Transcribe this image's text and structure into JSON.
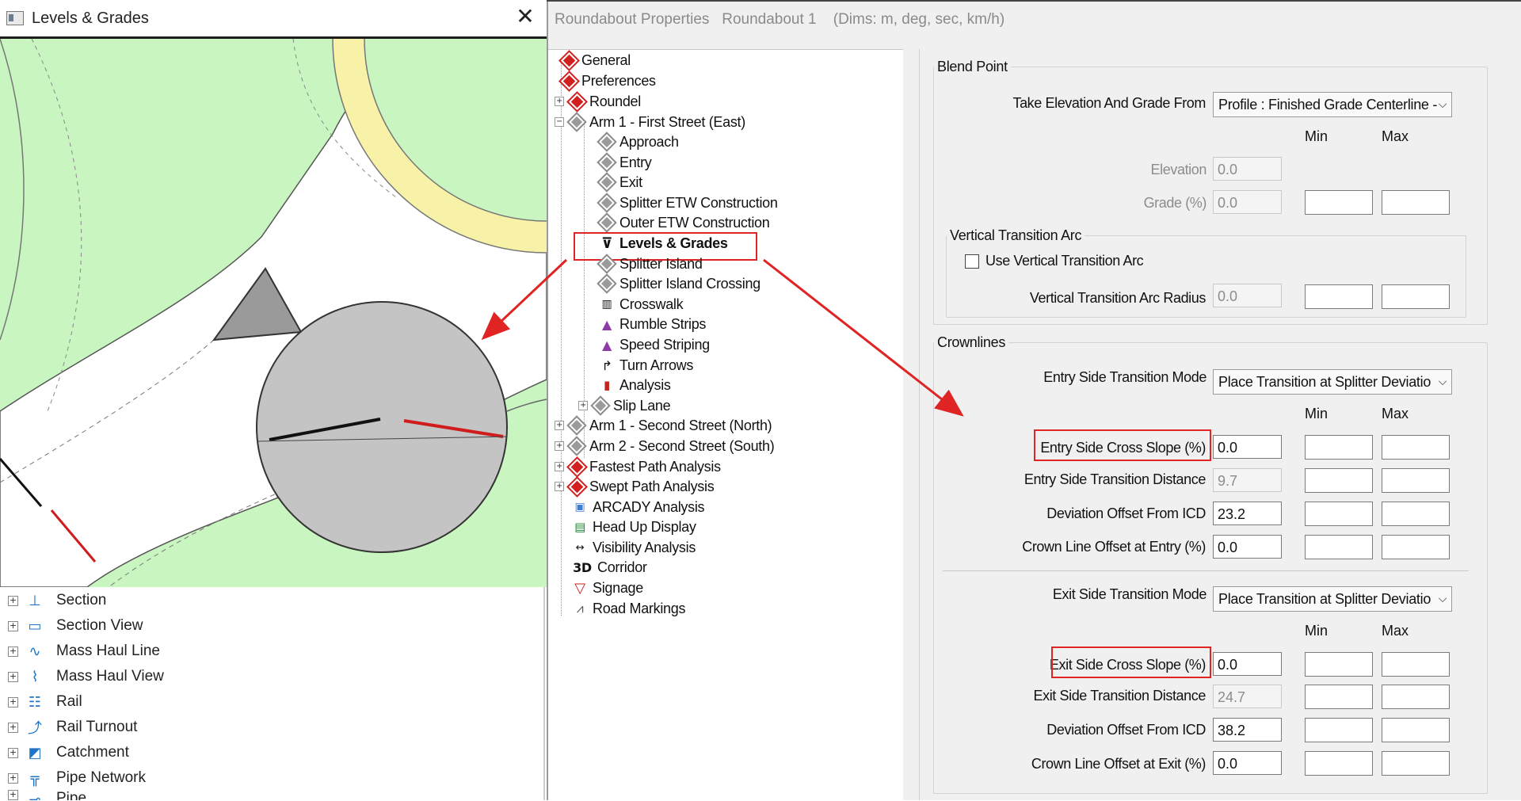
{
  "left_window": {
    "title": "Levels & Grades",
    "close_glyph": "✕"
  },
  "prospector": [
    {
      "label": "Section",
      "icon": "⊥"
    },
    {
      "label": "Section View",
      "icon": "▭"
    },
    {
      "label": "Mass Haul Line",
      "icon": "∿"
    },
    {
      "label": "Mass Haul View",
      "icon": "⌇"
    },
    {
      "label": "Rail",
      "icon": "☷"
    },
    {
      "label": "Rail Turnout",
      "icon": "⤴"
    },
    {
      "label": "Catchment",
      "icon": "◩"
    },
    {
      "label": "Pipe Network",
      "icon": "╦"
    },
    {
      "label": "Pipe",
      "icon": "⊸"
    }
  ],
  "dialog": {
    "title": "Roundabout Properties   Roundabout 1    (Dims: m, deg, sec, km/h)"
  },
  "tree": {
    "nodes": [
      {
        "label": "General"
      },
      {
        "label": "Preferences"
      },
      {
        "label": "Roundel"
      },
      {
        "label": "Arm 1 - First Street (East)"
      },
      {
        "label": "Approach"
      },
      {
        "label": "Entry"
      },
      {
        "label": "Exit"
      },
      {
        "label": "Splitter ETW Construction"
      },
      {
        "label": "Outer ETW Construction"
      },
      {
        "label": "Levels & Grades"
      },
      {
        "label": "Splitter Island"
      },
      {
        "label": "Splitter Island Crossing"
      },
      {
        "label": "Crosswalk"
      },
      {
        "label": "Rumble Strips"
      },
      {
        "label": "Speed Striping"
      },
      {
        "label": "Turn Arrows"
      },
      {
        "label": "Analysis"
      },
      {
        "label": "Slip Lane"
      },
      {
        "label": "Arm 1 - Second Street (North)"
      },
      {
        "label": "Arm 2 - Second Street (South)"
      },
      {
        "label": "Fastest Path Analysis"
      },
      {
        "label": "Swept Path Analysis"
      },
      {
        "label": "ARCADY Analysis"
      },
      {
        "label": "Head Up Display"
      },
      {
        "label": "Visibility Analysis"
      },
      {
        "label": "Corridor"
      },
      {
        "label": "Signage"
      },
      {
        "label": "Road Markings"
      }
    ],
    "glyphs": {
      "expand": "+",
      "collapse": "−",
      "corridor": "3D"
    }
  },
  "blend_point": {
    "legend": "Blend Point",
    "take_from_label": "Take Elevation And Grade From",
    "take_from_value": "Profile : Finished Grade Centerline -",
    "min_header": "Min",
    "max_header": "Max",
    "elevation_label": "Elevation",
    "elevation_value": "0.0",
    "grade_label": "Grade (%)",
    "grade_value": "0.0",
    "vta": {
      "legend": "Vertical Transition Arc",
      "use_label": "Use Vertical Transition Arc",
      "radius_label": "Vertical Transition Arc Radius",
      "radius_value": "0.0"
    }
  },
  "crownlines": {
    "legend": "Crownlines",
    "entry_mode_label": "Entry Side Transition Mode",
    "entry_mode_value": "Place Transition at Splitter Deviatio",
    "min_header": "Min",
    "max_header": "Max",
    "entry_cross_slope_label": "Entry Side Cross Slope (%)",
    "entry_cross_slope_value": "0.0",
    "entry_transition_distance_label": "Entry Side Transition Distance",
    "entry_transition_distance_value": "9.7",
    "entry_deviation_offset_label": "Deviation Offset From ICD",
    "entry_deviation_offset_value": "23.2",
    "crown_offset_entry_label": "Crown Line Offset at Entry (%)",
    "crown_offset_entry_value": "0.0",
    "exit_mode_label": "Exit Side Transition Mode",
    "exit_mode_value": "Place Transition at Splitter Deviatio",
    "exit_cross_slope_label": "Exit Side Cross Slope (%)",
    "exit_cross_slope_value": "0.0",
    "exit_transition_distance_label": "Exit Side Transition Distance",
    "exit_transition_distance_value": "24.7",
    "exit_deviation_offset_label": "Deviation Offset From ICD",
    "exit_deviation_offset_value": "38.2",
    "crown_offset_exit_label": "Crown Line Offset at Exit (%)",
    "crown_offset_exit_value": "0.0"
  },
  "colors": {
    "highlight": "#e02424",
    "grass": "#c8f5c0",
    "central_island_ring": "#f7f2a8"
  }
}
